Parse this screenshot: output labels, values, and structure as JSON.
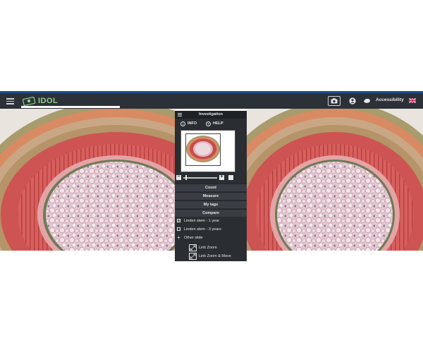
{
  "navbar": {
    "logo_text": "IDOL",
    "accessibility_label": "Accessibility",
    "icons": [
      "menu-icon",
      "camera-icon",
      "user-icon",
      "hand-icon",
      "uk-flag-icon"
    ],
    "colors": {
      "bar": "#2c3138",
      "accent": "#1f4f8a",
      "logo": "#8fd18a"
    }
  },
  "panel": {
    "title": "Investigation",
    "info_label": "INFO",
    "help_label": "HELP",
    "sections": {
      "count": "Count",
      "measure": "Measure",
      "mytags": "My tags",
      "compare": "Compare"
    },
    "compare_items": [
      {
        "label": "Linden stem - 1 year",
        "checked": true
      },
      {
        "label": "Linden stem - 3 years",
        "checked": false
      },
      {
        "label": "Other slide"
      }
    ],
    "link_options": [
      "Link Zoom",
      "Link Zoom & Move"
    ]
  }
}
